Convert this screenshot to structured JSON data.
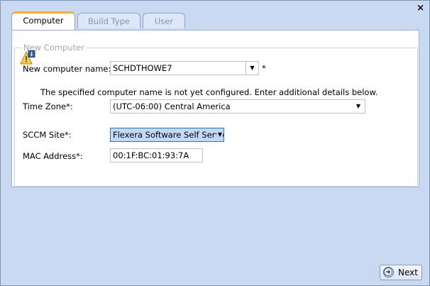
{
  "window": {
    "close_label": "×"
  },
  "tabs": [
    {
      "label": "Computer",
      "active": true
    },
    {
      "label": "Build Type",
      "active": false
    },
    {
      "label": "User",
      "active": false
    }
  ],
  "group_title": "New Computer",
  "computer_name": {
    "label": "New computer name:",
    "value": "SCHDTHOWE7",
    "required_mark": "*"
  },
  "warning": {
    "text": "The specified computer name is not yet configured. Enter additional details below."
  },
  "time_zone": {
    "label": "Time Zone*:",
    "value": "(UTC-06:00) Central America"
  },
  "sccm_site": {
    "label": "SCCM Site*:",
    "value": "Flexera Software Self Service"
  },
  "mac_address": {
    "label": "MAC Address*:",
    "value": "00:1F:BC:01:93:7A"
  },
  "next_button": {
    "label": "Next"
  },
  "colors": {
    "window_bg": "#c9d9f1",
    "active_tab_accent": "#f2b044",
    "selected_dropdown": "#c3d8f4"
  },
  "icons": [
    "close-icon",
    "warning-icon",
    "chevron-down-icon",
    "next-arrow-icon"
  ]
}
